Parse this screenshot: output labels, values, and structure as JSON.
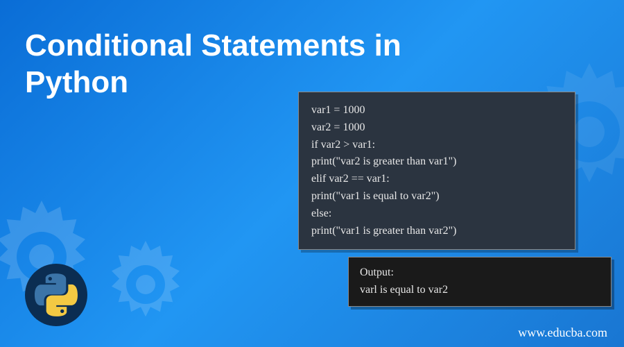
{
  "title_line1": "Conditional Statements in",
  "title_line2": "Python",
  "code": {
    "lines": [
      "var1 = 1000",
      "var2 = 1000",
      "if var2 > var1:",
      "print(\"var2 is greater than var1\")",
      "elif var2 == var1:",
      "print(\"var1 is equal to var2\")",
      "else:",
      "print(\"var1 is greater than var2\")"
    ]
  },
  "output": {
    "label": "Output:",
    "text": "varl is equal to var2"
  },
  "website": "www.educba.com",
  "colors": {
    "bg_gradient_start": "#0a6dd6",
    "bg_gradient_end": "#1976d2",
    "code_bg": "#2b3440",
    "output_bg": "#1a1a1a",
    "badge_bg": "#0b2d52",
    "text_white": "#ffffff",
    "code_text": "#e8e8e8"
  },
  "icons": {
    "logo": "python-logo",
    "decoration": "gear-icon"
  }
}
